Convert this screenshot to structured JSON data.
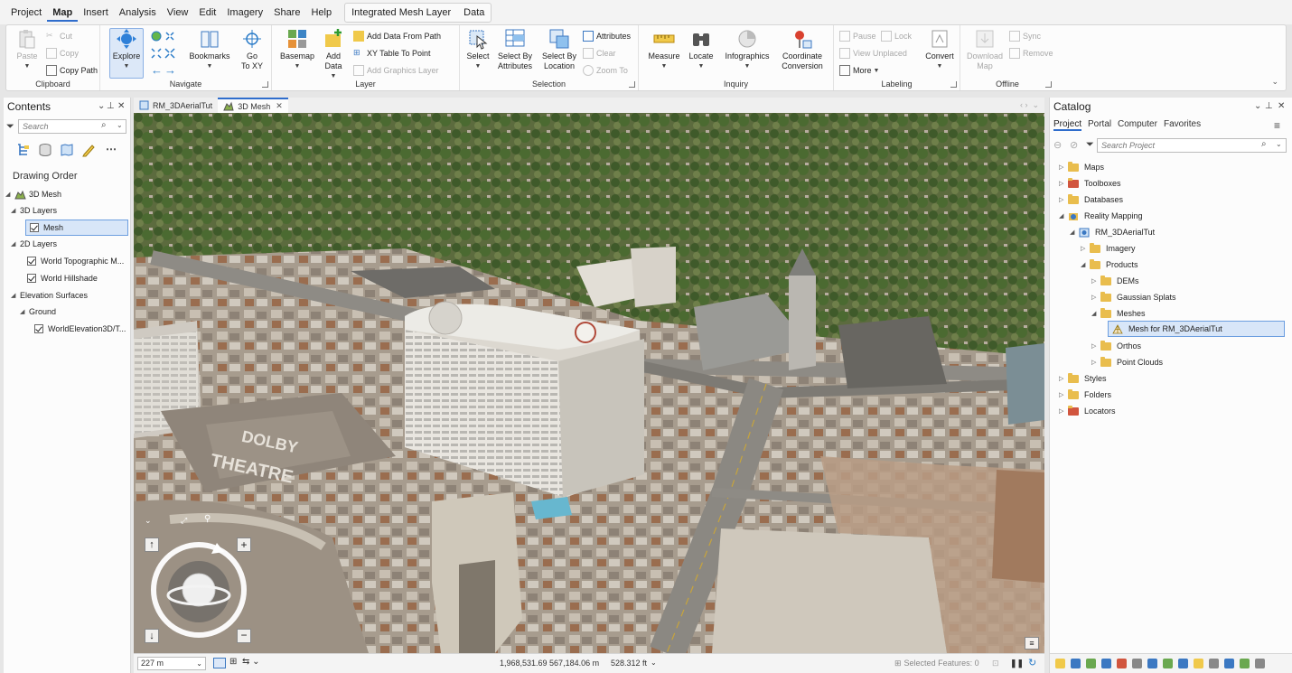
{
  "menubar": {
    "items": [
      "Project",
      "Map",
      "Insert",
      "Analysis",
      "View",
      "Edit",
      "Imagery",
      "Share",
      "Help"
    ],
    "active": "Map",
    "contextual": [
      "Integrated Mesh Layer",
      "Data"
    ]
  },
  "ribbon": {
    "clipboard": {
      "label": "Clipboard",
      "paste": "Paste",
      "cut": "Cut",
      "copy": "Copy",
      "copy_path": "Copy Path"
    },
    "navigate": {
      "label": "Navigate",
      "explore": "Explore",
      "bookmarks": "Bookmarks",
      "go_to_xy": "Go\nTo XY"
    },
    "layer": {
      "label": "Layer",
      "basemap": "Basemap",
      "add_data": "Add\nData",
      "add_data_from_path": "Add Data From Path",
      "xy_table_to_point": "XY Table To Point",
      "add_graphics_layer": "Add Graphics Layer"
    },
    "selection": {
      "label": "Selection",
      "select": "Select",
      "select_by_attributes": "Select By\nAttributes",
      "select_by_location": "Select By\nLocation",
      "attributes": "Attributes",
      "clear": "Clear",
      "zoom_to": "Zoom To"
    },
    "inquiry": {
      "label": "Inquiry",
      "measure": "Measure",
      "locate": "Locate",
      "infographics": "Infographics",
      "coordinate_conversion": "Coordinate\nConversion"
    },
    "labeling": {
      "label": "Labeling",
      "pause": "Pause",
      "lock": "Lock",
      "view_unplaced": "View Unplaced",
      "more": "More",
      "convert": "Convert"
    },
    "offline": {
      "label": "Offline",
      "download_map": "Download\nMap",
      "sync": "Sync",
      "remove": "Remove"
    }
  },
  "contents": {
    "title": "Contents",
    "search_placeholder": "Search",
    "section": "Drawing Order",
    "tree": [
      {
        "label": "3D Mesh",
        "level": 0
      },
      {
        "label": "3D Layers",
        "level": 1
      },
      {
        "label": "Mesh",
        "level": 2,
        "checked": true,
        "selected": true
      },
      {
        "label": "2D Layers",
        "level": 1
      },
      {
        "label": "World Topographic M...",
        "level": 2,
        "checked": true
      },
      {
        "label": "World Hillshade",
        "level": 2,
        "checked": true
      },
      {
        "label": "Elevation Surfaces",
        "level": 1
      },
      {
        "label": "Ground",
        "level": 2
      },
      {
        "label": "WorldElevation3D/T...",
        "level": 3,
        "checked": true
      }
    ]
  },
  "map": {
    "tabs": [
      "RM_3DAerialTut",
      "3D Mesh"
    ],
    "active_tab": "3D Mesh",
    "theatre_sign": [
      "DOLBY",
      "THEATRE"
    ],
    "scale": "227 m",
    "coordinates": "1,968,531.69 567,184.06 m",
    "elevation": "528.312 ft",
    "selected_features": "Selected Features: 0"
  },
  "catalog": {
    "title": "Catalog",
    "tabs": [
      "Project",
      "Portal",
      "Computer",
      "Favorites"
    ],
    "active_tab": "Project",
    "search_placeholder": "Search Project",
    "tree": [
      {
        "label": "Maps",
        "level": 0,
        "icon": "maps-icon"
      },
      {
        "label": "Toolboxes",
        "level": 0,
        "icon": "toolbox-icon"
      },
      {
        "label": "Databases",
        "level": 0,
        "icon": "database-icon"
      },
      {
        "label": "Reality Mapping",
        "level": 0,
        "icon": "reality-mapping-icon",
        "expanded": true
      },
      {
        "label": "RM_3DAerialTut",
        "level": 1,
        "icon": "workspace-icon",
        "expanded": true
      },
      {
        "label": "Imagery",
        "level": 2,
        "icon": "folder-icon"
      },
      {
        "label": "Products",
        "level": 2,
        "icon": "folder-icon",
        "expanded": true
      },
      {
        "label": "DEMs",
        "level": 3,
        "icon": "folder-icon"
      },
      {
        "label": "Gaussian Splats",
        "level": 3,
        "icon": "folder-icon"
      },
      {
        "label": "Meshes",
        "level": 3,
        "icon": "folder-icon",
        "expanded": true
      },
      {
        "label": "Mesh for RM_3DAerialTut",
        "level": 4,
        "icon": "mesh-icon",
        "selected": true
      },
      {
        "label": "Orthos",
        "level": 3,
        "icon": "folder-icon"
      },
      {
        "label": "Point Clouds",
        "level": 3,
        "icon": "folder-icon"
      },
      {
        "label": "Styles",
        "level": 0,
        "icon": "styles-icon"
      },
      {
        "label": "Folders",
        "level": 0,
        "icon": "folders-icon"
      },
      {
        "label": "Locators",
        "level": 0,
        "icon": "locators-icon"
      }
    ]
  },
  "colors": {
    "accent": "#2f6dcc",
    "selection_fill": "#d8e6f8",
    "folder": "#e9bd4d"
  }
}
